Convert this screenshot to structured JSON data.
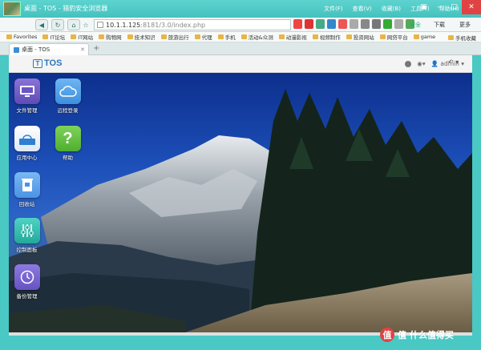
{
  "browser": {
    "title": "桌面 - TOS - 猎豹安全浏览器",
    "menus": [
      "文件(F)",
      "查看(V)",
      "收藏(B)",
      "工具(T)",
      "帮助(H)"
    ],
    "address": {
      "host": "10.1.1.125",
      "rest": ":8181/3.0/index.php"
    },
    "safe_label": "安全",
    "download_label": "下载",
    "more_label": "更多"
  },
  "bookmarks": {
    "items": [
      "Favorites",
      "IT论坛",
      "IT网站",
      "购物网",
      "技术知识",
      "旅游出行",
      "代理",
      "手机",
      "活动&众测",
      "动漫影视",
      "视频制作",
      "投资网站",
      "网贷平台",
      "game"
    ],
    "right": "手机收藏"
  },
  "tabs": [
    {
      "label": "桌面 - TOS"
    }
  ],
  "tos": {
    "logo_text": "TOS",
    "logo_mark": "T",
    "user": "admin"
  },
  "desktop": {
    "icons": [
      {
        "label": "文件管理",
        "icon": "file-manager-icon"
      },
      {
        "label": "远程登录",
        "icon": "cloud-icon"
      },
      {
        "label": "应用中心",
        "icon": "app-center-icon"
      },
      {
        "label": "帮助",
        "icon": "help-icon"
      },
      {
        "label": "回收站",
        "icon": "recycle-bin-icon"
      },
      {
        "label": "控制面板",
        "icon": "control-panel-icon"
      },
      {
        "label": "备份管理",
        "icon": "backup-icon"
      }
    ]
  },
  "watermark": {
    "text": "值 什么值得买",
    "mark": "值"
  }
}
